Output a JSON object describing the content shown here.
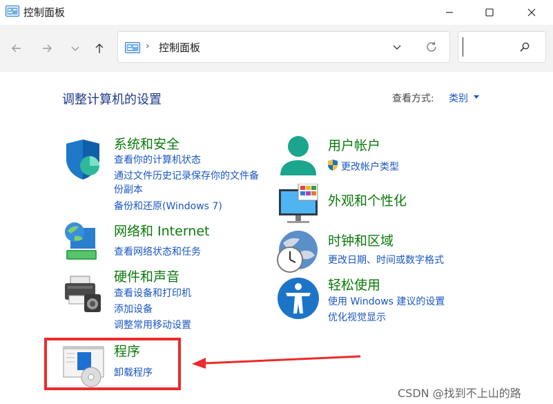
{
  "window": {
    "title": "控制面板"
  },
  "navigation": {
    "breadcrumb_separator": "›",
    "breadcrumb": "控制面板",
    "search_placeholder": ""
  },
  "content": {
    "heading": "调整计算机的设置",
    "view_by_label": "查看方式:",
    "view_by_value": "类别"
  },
  "categories": {
    "system_security": {
      "title": "系统和安全",
      "links": [
        "查看你的计算机状态",
        "通过文件历史记录保存你的文件备",
        "份副本",
        "备份和还原(Windows 7)"
      ]
    },
    "network": {
      "title": "网络和 Internet",
      "links": [
        "查看网络状态和任务"
      ]
    },
    "hardware": {
      "title": "硬件和声音",
      "links": [
        "查看设备和打印机",
        "添加设备",
        "调整常用移动设置"
      ]
    },
    "programs": {
      "title": "程序",
      "links": [
        "卸载程序"
      ]
    },
    "user_accounts": {
      "title": "用户帐户",
      "links": [
        "更改帐户类型"
      ]
    },
    "appearance": {
      "title": "外观和个性化",
      "links": []
    },
    "clock_region": {
      "title": "时钟和区域",
      "links": [
        "更改日期、时间或数字格式"
      ]
    },
    "ease_of_access": {
      "title": "轻松使用",
      "links": [
        "使用 Windows 建议的设置",
        "优化视觉显示"
      ]
    }
  },
  "annotation": {
    "highlight_color": "#ee2a2a"
  },
  "watermark": "CSDN @找到不上山的路",
  "colors": {
    "category_title": "#0b7a0b",
    "link": "#1a56c4",
    "heading": "#1e3a8a"
  }
}
